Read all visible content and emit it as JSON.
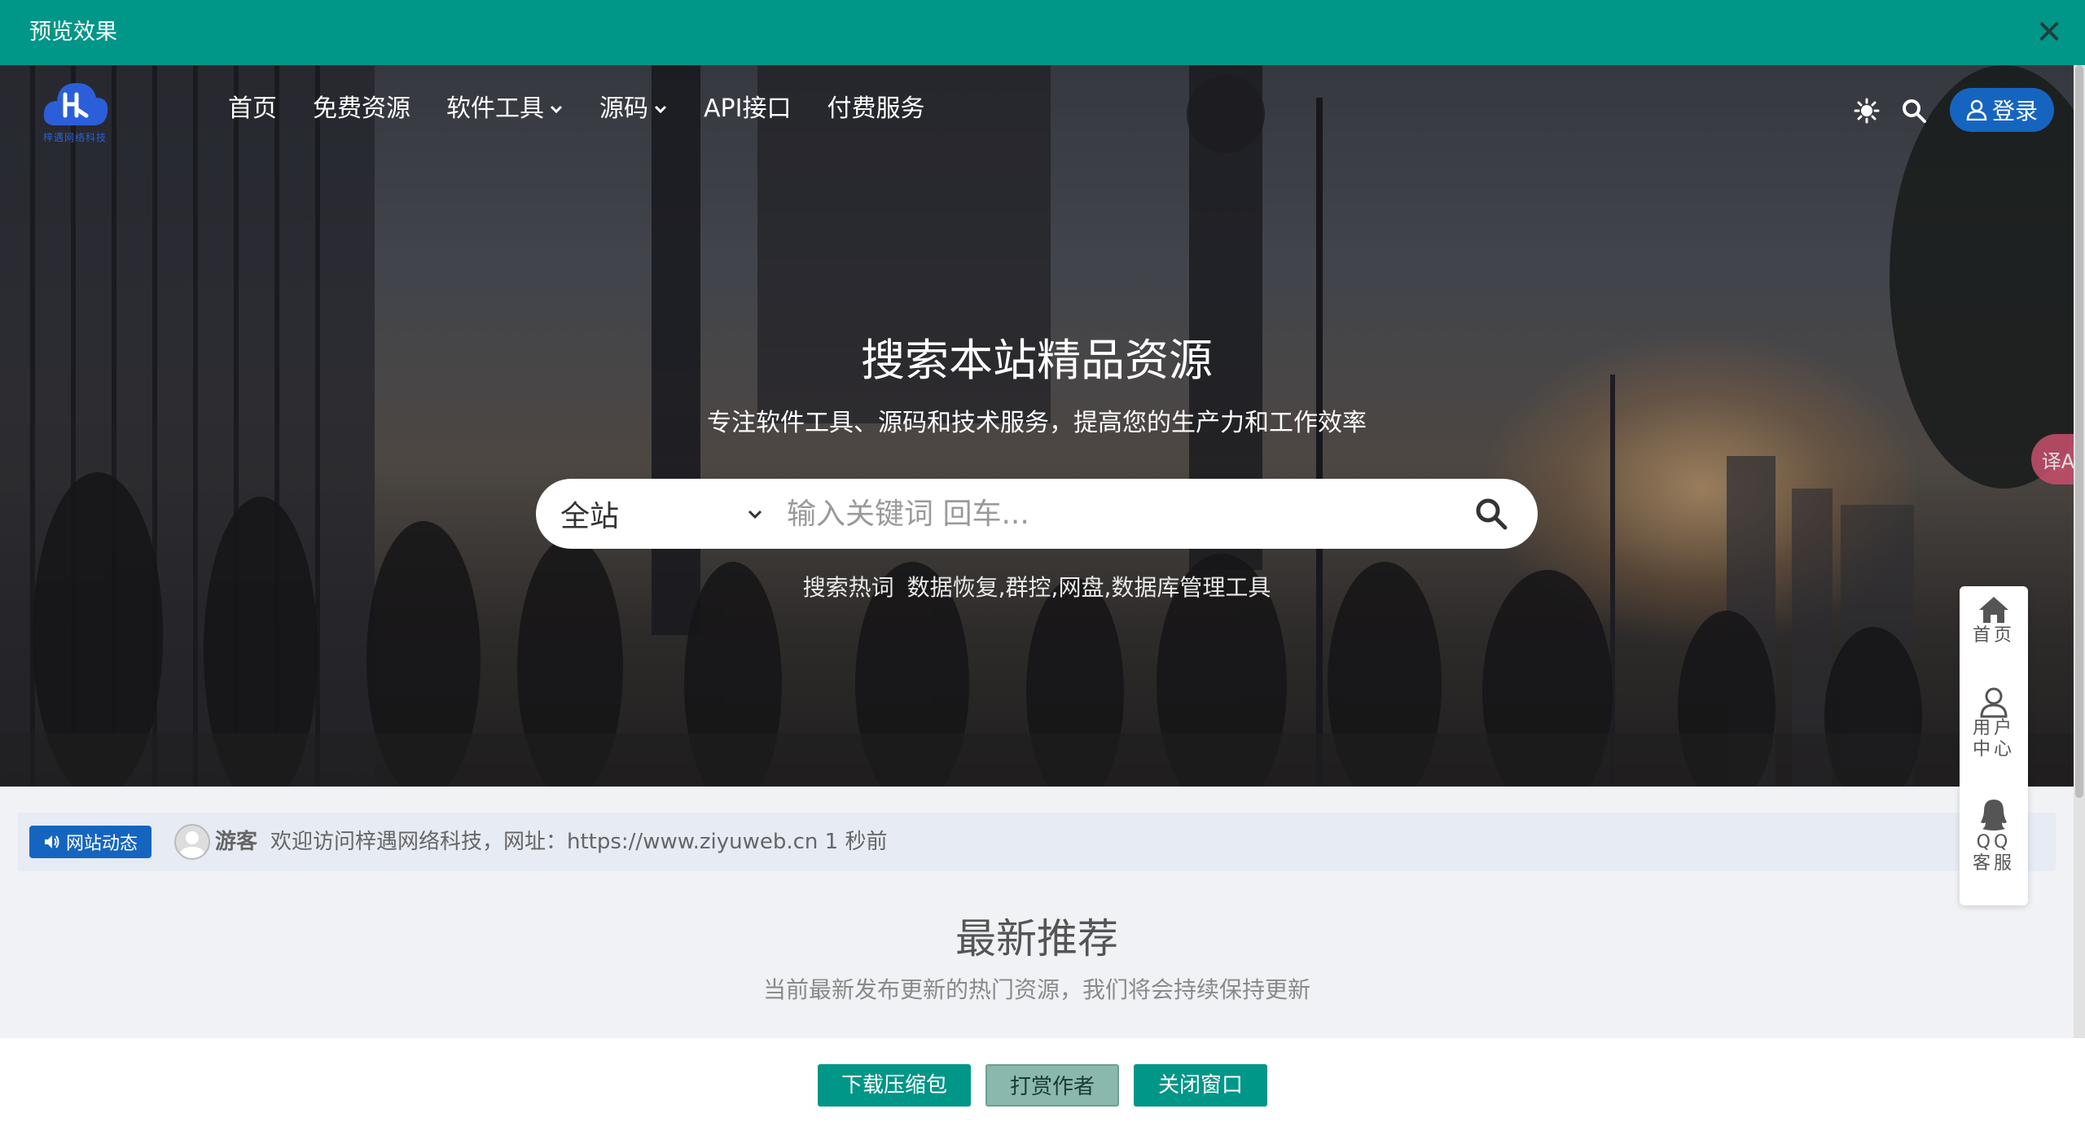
{
  "preview": {
    "title": "预览效果",
    "close_label": "✕"
  },
  "header": {
    "logo_text": "梓遇网络科技",
    "nav": [
      {
        "label": "首页",
        "has_dropdown": false
      },
      {
        "label": "免费资源",
        "has_dropdown": false
      },
      {
        "label": "软件工具",
        "has_dropdown": true
      },
      {
        "label": "源码",
        "has_dropdown": true
      },
      {
        "label": "API接口",
        "has_dropdown": false
      },
      {
        "label": "付费服务",
        "has_dropdown": false
      }
    ],
    "login_label": "登录"
  },
  "hero": {
    "title": "搜索本站精品资源",
    "subtitle": "专注软件工具、源码和技术服务，提高您的生产力和工作效率",
    "search": {
      "scope": "全站",
      "placeholder": "输入关键词 回车..."
    },
    "hot_label": "搜索热词",
    "hot_terms": "数据恢复,群控,网盘,数据库管理工具"
  },
  "lang_badge": "译A",
  "notice": {
    "badge": "网站动态",
    "user": "游客",
    "message": "欢迎访问梓遇网络科技，网址：https://www.ziyuweb.cn  1 秒前"
  },
  "section": {
    "title": "最新推荐",
    "subtitle": "当前最新发布更新的热门资源，我们将会持续保持更新"
  },
  "side_toolbar": {
    "home": "首页",
    "user_center_1": "用户",
    "user_center_2": "中心",
    "qq_1": "QQ",
    "qq_2": "客服"
  },
  "bottom_buttons": {
    "download": "下载压缩包",
    "reward": "打赏作者",
    "close": "关闭窗口"
  },
  "colors": {
    "teal": "#009688",
    "blue": "#1565c0"
  }
}
